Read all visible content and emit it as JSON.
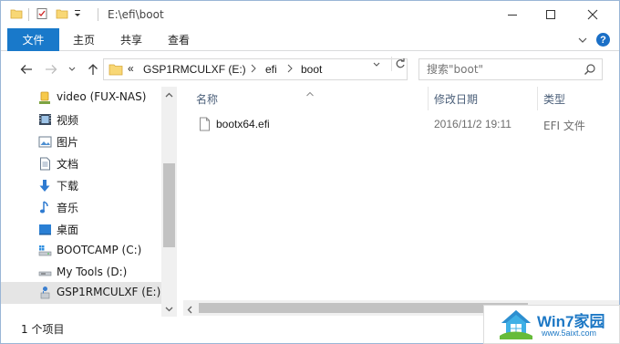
{
  "window": {
    "title": "E:\\efi\\boot",
    "minimize": "—",
    "maximize": "☐",
    "close": "✕"
  },
  "ribbon": {
    "file_tab": "文件",
    "tabs": [
      "主页",
      "共享",
      "查看"
    ],
    "help": "?"
  },
  "address": {
    "overflow": "«",
    "crumbs": [
      "GSP1RMCULXF (E:)",
      "efi",
      "boot"
    ]
  },
  "search": {
    "placeholder": "搜索\"boot\""
  },
  "sidebar": {
    "items": [
      {
        "label": "video (FUX-NAS)",
        "icon": "network-drive-icon"
      },
      {
        "label": "视频",
        "icon": "video-library-icon"
      },
      {
        "label": "图片",
        "icon": "pictures-library-icon"
      },
      {
        "label": "文档",
        "icon": "documents-library-icon"
      },
      {
        "label": "下载",
        "icon": "downloads-icon"
      },
      {
        "label": "音乐",
        "icon": "music-icon"
      },
      {
        "label": "桌面",
        "icon": "desktop-icon"
      },
      {
        "label": "BOOTCAMP (C:)",
        "icon": "system-drive-icon"
      },
      {
        "label": "My Tools (D:)",
        "icon": "local-drive-icon"
      },
      {
        "label": "GSP1RMCULXF (E:)",
        "icon": "usb-drive-icon",
        "selected": true
      }
    ]
  },
  "columns": {
    "name": "名称",
    "modified": "修改日期",
    "type": "类型"
  },
  "files": [
    {
      "name": "bootx64.efi",
      "modified": "2016/11/2 19:11",
      "type": "EFI 文件"
    }
  ],
  "status": {
    "item_count": "1 个项目"
  },
  "watermark": {
    "title": "Win7家园",
    "url": "www.5aixt.com"
  },
  "colors": {
    "accent": "#1979ca",
    "selection": "#cce8ff",
    "folder": "#f8d775"
  }
}
